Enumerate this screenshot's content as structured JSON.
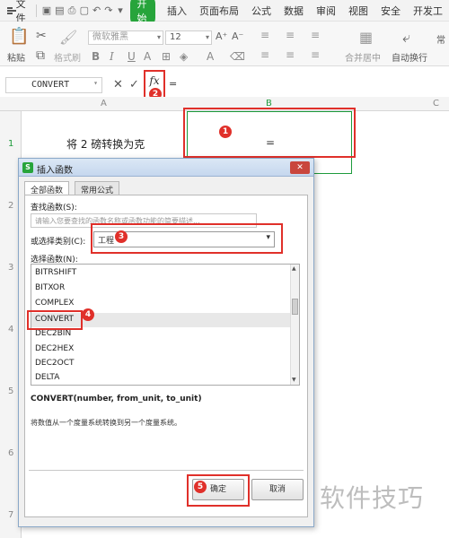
{
  "menubar": {
    "file": "文件",
    "start": "开始",
    "tabs": [
      "插入",
      "页面布局",
      "公式",
      "数据",
      "审阅",
      "视图",
      "安全",
      "开发工"
    ]
  },
  "ribbon": {
    "paste": "粘贴",
    "format_painter": "格式刷",
    "font_name": "微软雅黑",
    "font_size": "12",
    "merge_center": "合并居中",
    "wrap_text": "自动换行",
    "cut_off_label": "常"
  },
  "formula_bar": {
    "name_box": "CONVERT",
    "fx": "fx",
    "value": "="
  },
  "grid": {
    "columns": [
      "A",
      "B",
      "C"
    ],
    "rows": [
      "1",
      "2",
      "3",
      "4",
      "5",
      "6",
      "7"
    ],
    "a1": "将 2 磅转换为克",
    "b1": "="
  },
  "badges": [
    "1",
    "2",
    "3",
    "4",
    "5"
  ],
  "dialog": {
    "title": "插入函数",
    "logo": "S",
    "tabs": [
      "全部函数",
      "常用公式"
    ],
    "search_label": "查找函数(S):",
    "search_placeholder": "请输入您要查找的函数名称或函数功能的简要描述...",
    "category_label": "或选择类别(C):",
    "category_value": "工程",
    "list_label": "选择函数(N):",
    "functions": [
      "BITRSHIFT",
      "BITXOR",
      "COMPLEX",
      "CONVERT",
      "DEC2BIN",
      "DEC2HEX",
      "DEC2OCT",
      "DELTA"
    ],
    "selected_function": "CONVERT",
    "signature": "CONVERT(number, from_unit, to_unit)",
    "description": "将数值从一个度量系统转换到另一个度量系统。",
    "ok": "确定",
    "cancel": "取消"
  },
  "watermark": "软件技巧"
}
